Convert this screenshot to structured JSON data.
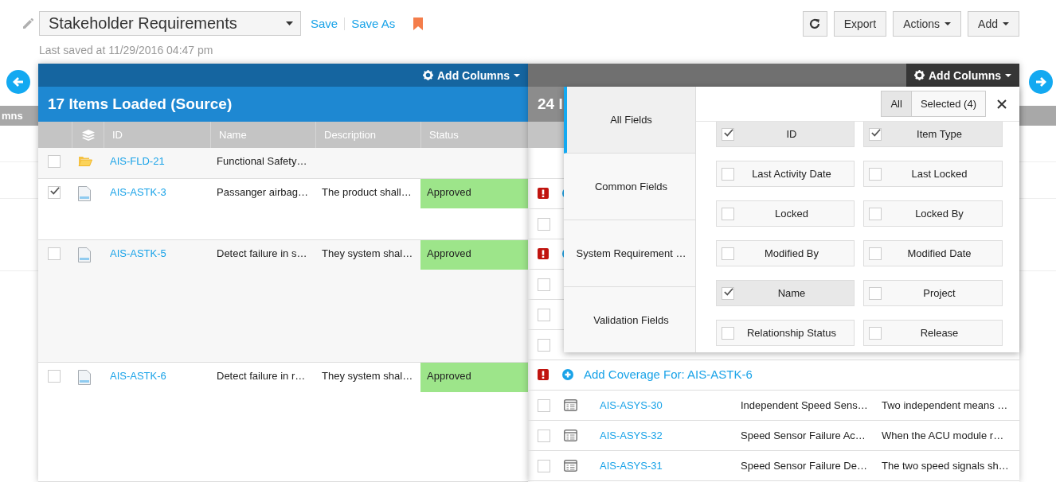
{
  "header": {
    "view_name": "Stakeholder Requirements",
    "save": "Save",
    "save_as": "Save As",
    "last_saved": "Last saved at 11/29/2016 04:47 pm",
    "buttons": [
      {
        "label": "Export",
        "caret": false
      },
      {
        "label": "Actions",
        "caret": true
      },
      {
        "label": "Add",
        "caret": true
      }
    ]
  },
  "behind_left": {
    "label": "mns"
  },
  "source_panel": {
    "add_columns": "Add Columns",
    "title": "17 Items Loaded (Source)",
    "columns": [
      "ID",
      "Name",
      "Description",
      "Status"
    ],
    "rows": [
      {
        "checked": false,
        "kind": "folder",
        "id": "AIS-FLD-21",
        "name": "Functional Safety…"
      },
      {
        "checked": true,
        "kind": "document",
        "id": "AIS-ASTK-3",
        "name": "Passanger airbag…",
        "description": "The product shall…",
        "status": "Approved"
      },
      {
        "checked": false,
        "kind": "document",
        "id": "AIS-ASTK-5",
        "name": "Detect failure in s…",
        "description": "They system shal…",
        "status": "Approved"
      },
      {
        "checked": false,
        "kind": "document",
        "id": "AIS-ASTK-6",
        "name": "Detect failure in r…",
        "description": "They system shal…",
        "status": "Approved"
      }
    ]
  },
  "target_panel": {
    "add_columns": "Add Columns",
    "title": "24 I",
    "rows": [
      {
        "kind": "coverage"
      },
      {
        "kind": "item",
        "checked": false
      },
      {
        "kind": "coverage"
      },
      {
        "kind": "item",
        "checked": false
      },
      {
        "kind": "item",
        "checked": false
      },
      {
        "kind": "item",
        "checked": false
      },
      {
        "kind": "coverage",
        "label": "Add Coverage For: AIS-ASTK-6"
      },
      {
        "kind": "item",
        "checked": false,
        "id": "AIS-ASYS-30",
        "name": "Independent Speed Sens…",
        "description": "Two independent means …"
      },
      {
        "kind": "item",
        "checked": false,
        "id": "AIS-ASYS-32",
        "name": "Speed Sensor Failure Ac…",
        "description": "When the ACU module r…"
      },
      {
        "kind": "item",
        "checked": false,
        "id": "AIS-ASYS-31",
        "name": "Speed Sensor Failure De…",
        "description": "The two speed signals sh…"
      }
    ],
    "column_picker": {
      "tabs": [
        {
          "label": "All Fields",
          "selected": true
        },
        {
          "label": "Common Fields",
          "selected": false
        },
        {
          "label": "System Requirement …",
          "selected": false
        },
        {
          "label": "Validation Fields",
          "selected": false
        }
      ],
      "filters": [
        {
          "label": "All",
          "selected": true
        },
        {
          "label": "Selected (4)",
          "selected": false
        }
      ],
      "fields": [
        {
          "label": "ID",
          "checked": true
        },
        {
          "label": "Item Type",
          "checked": true
        },
        {
          "label": "Last Activity Date",
          "checked": false
        },
        {
          "label": "Last Locked",
          "checked": false
        },
        {
          "label": "Locked",
          "checked": false
        },
        {
          "label": "Locked By",
          "checked": false
        },
        {
          "label": "Modified By",
          "checked": false
        },
        {
          "label": "Modified Date",
          "checked": false
        },
        {
          "label": "Name",
          "checked": true
        },
        {
          "label": "Project",
          "checked": false
        },
        {
          "label": "Relationship Status",
          "checked": false
        },
        {
          "label": "Release",
          "checked": false
        }
      ]
    }
  }
}
